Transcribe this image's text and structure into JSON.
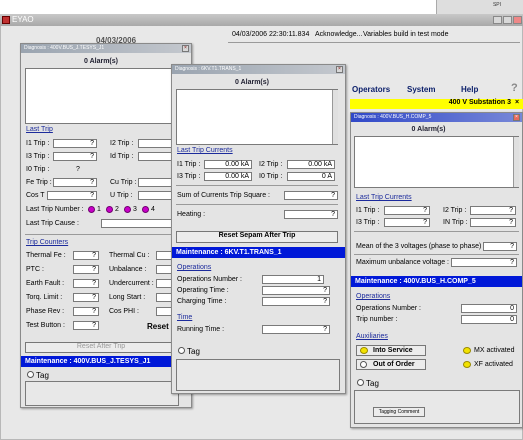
{
  "app": {
    "title": "EYAO",
    "notice": {
      "timestamp": "04/03/2006  22:30:11.834",
      "action": "Acknowledge...",
      "message": "Variables build in test mode"
    },
    "corner_text": "SPI",
    "date_fragment": "04/03/2006"
  },
  "menu": {
    "items": [
      "Operators",
      "System",
      "Help"
    ],
    "help_icon": "?"
  },
  "substation_bar": "400 V Substation 3",
  "dlg1": {
    "title": "Diagnosis : 400V.BUS_J.TESYS_J1",
    "alarms_header": "0 Alarm(s)",
    "last_trip": {
      "heading": "Last Trip",
      "i1": "I1 Trip :",
      "i1v": "?",
      "i2": "I2 Trip :",
      "i3": "I3 Trip :",
      "i3v": "?",
      "id": "Id Trip :",
      "i0": "I0 Trip :",
      "i0v": "?",
      "fe": "Fe Trip :",
      "fev": "?",
      "cu": "Cu Trip :",
      "cos": "Cos T :",
      "cosv": "?",
      "u": "U Trip :",
      "number": "Last Trip Number :",
      "b1": "1",
      "b2": "2",
      "b3": "3",
      "b4": "4",
      "cause": "Last Trip Cause :"
    },
    "counters": {
      "heading": "Trip Counters",
      "thermal_fe": "Thermal Fe :",
      "thermal_fe_v": "?",
      "thermal_cu": "Thermal Cu :",
      "ptc": "PTC :",
      "ptc_v": "?",
      "unbalance": "Unbalance :",
      "earth": "Earth Fault :",
      "earth_v": "?",
      "undercurrent": "Undercurrent :",
      "torq": "Torq. Limit :",
      "torq_v": "?",
      "long_start": "Long Start :",
      "phase_rev": "Phase Rev :",
      "phase_rev_v": "?",
      "cos_phi": "Cos PHI :",
      "test": "Test Button :",
      "test_v": "?",
      "reset": "Reset"
    },
    "reset_after_trip": "Reset After Trip",
    "maintenance": "Maintenance : 400V.BUS_J.TESYS_J1",
    "tag": "Tag"
  },
  "dlg2": {
    "title": "Diagnosis : 6KV.T1.TRANS_1",
    "alarms_header": "0 Alarm(s)",
    "currents": {
      "heading": "Last Trip Currents",
      "i1": "I1 Trip :",
      "i1v": "0.00 kA",
      "i2": "I2 Trip :",
      "i2v": "0.00 kA",
      "i3": "I3 Trip :",
      "i3v": "0.00 kA",
      "i0": "I0 Trip :",
      "i0v": "0 A"
    },
    "sum_label": "Sum of Currents Trip Square :",
    "sum_v": "?",
    "heating": "Heating :",
    "heating_v": "?",
    "reset_sepam": "Reset Sepam After Trip",
    "maintenance": "Maintenance : 6KV.T1.TRANS_1",
    "operations": {
      "heading": "Operations",
      "number": "Operations Number :",
      "number_v": "1",
      "op_time": "Operating Time :",
      "op_time_v": "?",
      "charging": "Charging Time :",
      "charging_v": "?"
    },
    "time": {
      "heading": "Time",
      "running": "Running Time :",
      "running_v": "?"
    },
    "tag": "Tag"
  },
  "dlg3": {
    "title": "Diagnosis : 400V.BUS_H.COMP_5",
    "alarms_header": "0 Alarm(s)",
    "currents": {
      "heading": "Last Trip Currents",
      "i1": "I1 Trip :",
      "i1v": "?",
      "i2": "I2 Trip :",
      "i2v": "?",
      "i3": "I3 Trip :",
      "i3v": "?",
      "in": "IN Trip :",
      "inv": "?"
    },
    "mean_label": "Mean of the 3 voltages (phase to phase) :",
    "mean_v": "?",
    "max_unb": "Maximum unbalance voltage :",
    "max_unb_v": "?",
    "maintenance": "Maintenance : 400V.BUS_H.COMP_5",
    "operations": {
      "heading": "Operations",
      "number": "Operations Number :",
      "number_v": "0",
      "trip": "Trip number :",
      "trip_v": "0"
    },
    "aux": {
      "heading": "Auxiliaries",
      "into_service": "Into Service",
      "out_of_order": "Out of Order",
      "mx": "MX activated",
      "xf": "XF  activated"
    },
    "tag": "Tag",
    "tagging_comment": "Tagging Comment"
  }
}
